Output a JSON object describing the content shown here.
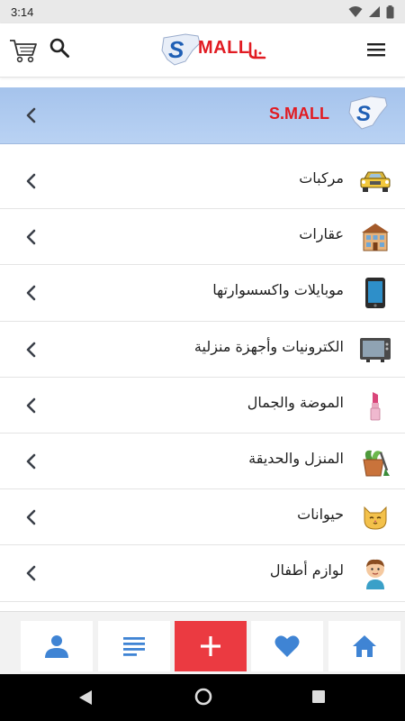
{
  "status_bar": {
    "time": "3:14"
  },
  "header": {
    "logo_text": "MALL",
    "logo_letter": "S"
  },
  "banner": {
    "title": "S.MALL",
    "logo_letter": "S"
  },
  "categories": [
    {
      "label": "مركبات",
      "icon": "car-icon"
    },
    {
      "label": "عقارات",
      "icon": "building-icon"
    },
    {
      "label": "موبايلات واكسسوارتها",
      "icon": "mobile-phone-icon"
    },
    {
      "label": "الكترونيات وأجهزة منزلية",
      "icon": "tv-icon"
    },
    {
      "label": "الموضة والجمال",
      "icon": "lipstick-icon"
    },
    {
      "label": "المنزل والحديقة",
      "icon": "plant-pot-icon"
    },
    {
      "label": "حيوانات",
      "icon": "cat-icon"
    },
    {
      "label": "لوازم أطفال",
      "icon": "child-icon"
    }
  ],
  "bottom_nav": [
    {
      "name": "profile",
      "icon": "user-icon"
    },
    {
      "name": "list",
      "icon": "list-icon"
    },
    {
      "name": "add",
      "icon": "plus-icon"
    },
    {
      "name": "favorites",
      "icon": "heart-icon"
    },
    {
      "name": "home",
      "icon": "home-icon"
    }
  ],
  "colors": {
    "accent_red": "#e11b22",
    "nav_blue": "#3f84d4",
    "add_button": "#eb3a41",
    "banner": "#b1cbf0"
  }
}
